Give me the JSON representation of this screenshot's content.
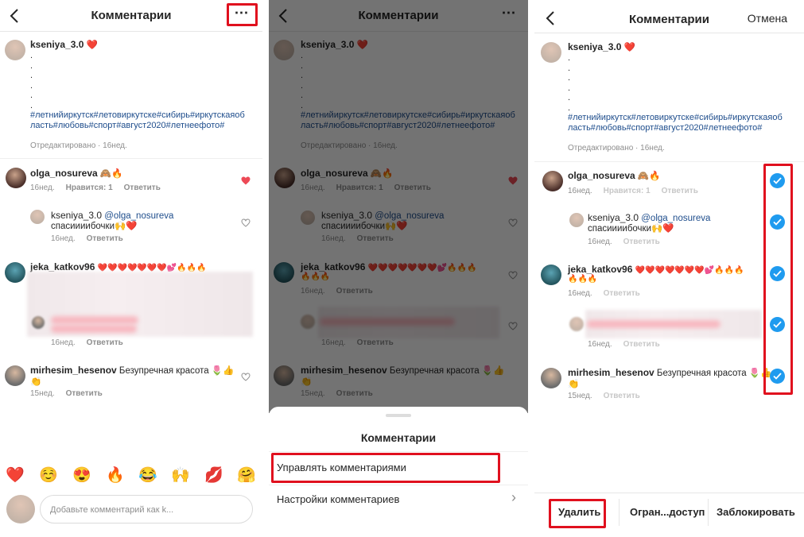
{
  "header": {
    "title": "Комментарии",
    "more_icon": "⋯",
    "cancel": "Отмена"
  },
  "post": {
    "username": "kseniya_3.0",
    "emoji": "❤️",
    "dots": [
      ".",
      ".",
      ".",
      ".",
      ".",
      "."
    ],
    "tags_line1": "#летнийиркутск#летовиркутске#сибирь#иркутскаяоб",
    "tags_line2": "ласть#любовь#спорт#август2020#летнеефото#",
    "tags_line2b": "ласть#любовь#спорт#август2020#летнеефото#",
    "tags3_line1": "#летнийиркутск#летовиркутске#сибирь#иркутскаяоб",
    "tags3_line2": "ласть#любовь#спорт#август2020#летнеефото#",
    "meta": "Отредактировано · 16нед."
  },
  "comments": [
    {
      "username": "olga_nosureva",
      "text": "🙈🔥",
      "time": "16нед.",
      "likes": "Нравится: 1",
      "reply": "Ответить"
    },
    {
      "username": "kseniya_3.0",
      "mention": "@olga_nosureva",
      "text": "спасиииибочки🙌❤️",
      "time": "16нед.",
      "reply": "Ответить"
    },
    {
      "username": "jeka_katkov96",
      "text": "❤️❤️❤️❤️❤️❤️❤️💕🔥🔥🔥",
      "text2": "🔥🔥🔥",
      "time": "16нед.",
      "reply": "Ответить"
    },
    {
      "time": "16нед.",
      "reply": "Ответить"
    },
    {
      "username": "mirhesim_hesenov",
      "text": "Безупречная красота 🌷👍",
      "text2": "👏",
      "time": "15нед.",
      "reply": "Ответить"
    }
  ],
  "emoji_bar": [
    "❤️",
    "☺️",
    "😍",
    "🔥",
    "😂",
    "🙌",
    "💋",
    "🤗"
  ],
  "input": {
    "placeholder": "Добавьте комментарий как k..."
  },
  "sheet": {
    "title": "Комментарии",
    "manage": "Управлять комментариями",
    "settings": "Настройки комментариев",
    "chevron": "›"
  },
  "actions": {
    "delete": "Удалить",
    "restrict": "Огран...доступ",
    "block": "Заблокировать"
  },
  "colors": {
    "accent_red": "#e0101e",
    "check_blue": "#1f9bef",
    "tag_blue": "#1e4d8c",
    "like_red": "#ed4956"
  }
}
